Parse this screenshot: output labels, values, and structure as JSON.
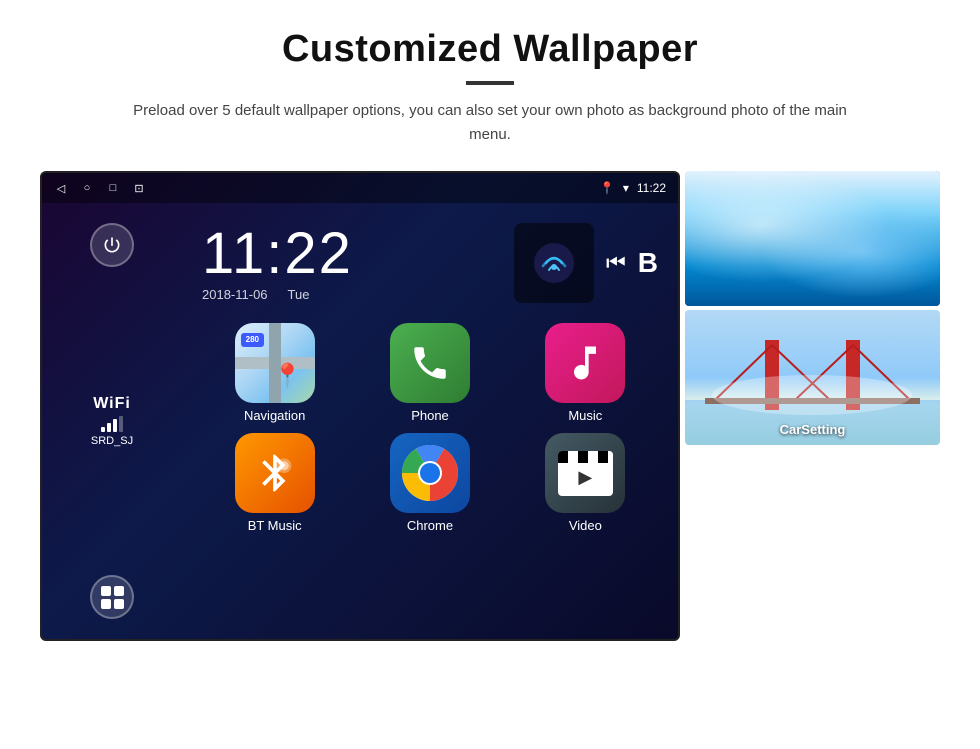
{
  "page": {
    "title": "Customized Wallpaper",
    "description": "Preload over 5 default wallpaper options, you can also set your own photo as background photo of the main menu."
  },
  "statusBar": {
    "time": "11:22",
    "icons": [
      "back-arrow",
      "home-circle",
      "square",
      "image"
    ],
    "rightIcons": [
      "location-pin",
      "wifi",
      "time"
    ]
  },
  "clockWidget": {
    "time": "11:22",
    "date": "2018-11-06",
    "day": "Tue"
  },
  "wifiInfo": {
    "label": "WiFi",
    "network": "SRD_SJ",
    "bars": 3
  },
  "apps": [
    {
      "id": "navigation",
      "label": "Navigation",
      "type": "nav"
    },
    {
      "id": "phone",
      "label": "Phone",
      "type": "phone"
    },
    {
      "id": "music",
      "label": "Music",
      "type": "music"
    },
    {
      "id": "bt-music",
      "label": "BT Music",
      "type": "bt"
    },
    {
      "id": "chrome",
      "label": "Chrome",
      "type": "chrome"
    },
    {
      "id": "video",
      "label": "Video",
      "type": "video"
    }
  ],
  "wallpapers": [
    {
      "id": "ice",
      "type": "ice",
      "hasBottomStrip": true
    },
    {
      "id": "bridge",
      "type": "bridge",
      "label": "CarSetting"
    }
  ],
  "navBadge": "280",
  "navBadgeLabel": "Navigation"
}
